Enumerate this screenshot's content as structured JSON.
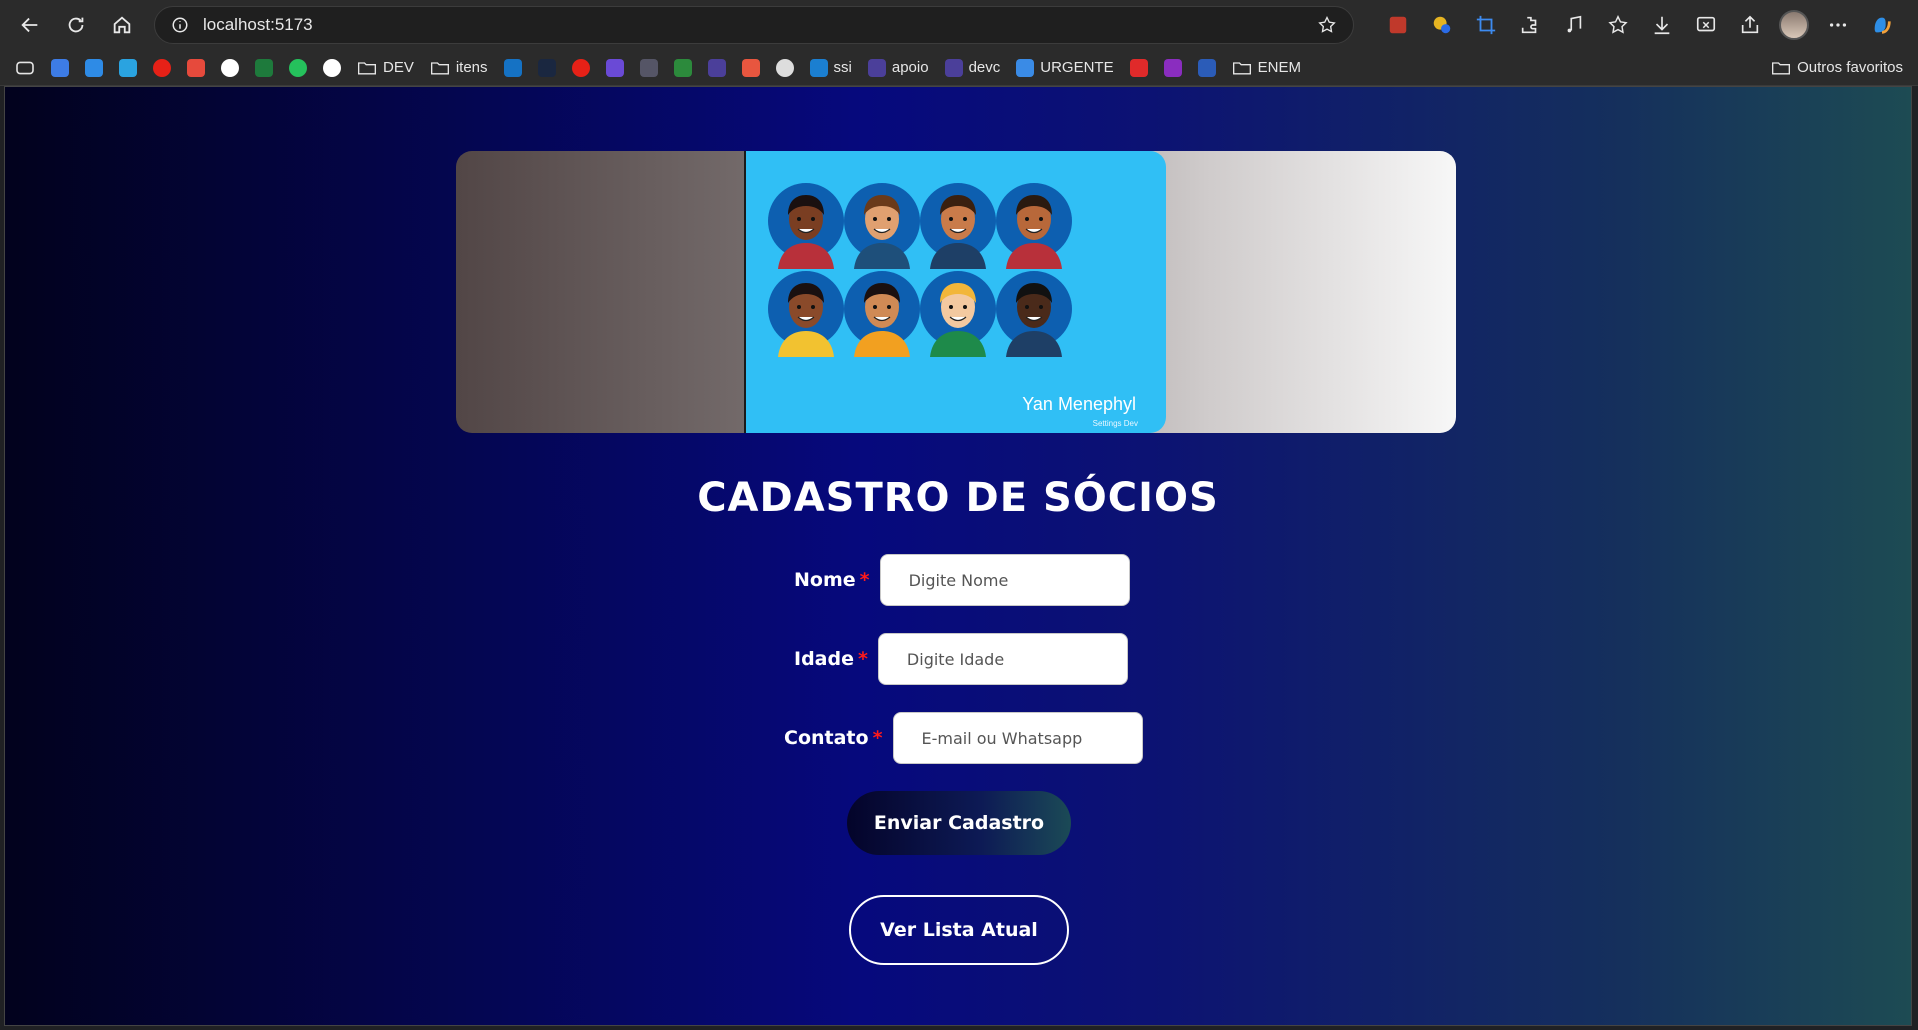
{
  "browser": {
    "url": "localhost:5173",
    "bookmarks": [
      {
        "label": "",
        "icon": "calendar-icon",
        "color": "#3d7ce6"
      },
      {
        "label": "",
        "icon": "onedrive-icon",
        "color": "#2e8be6"
      },
      {
        "label": "",
        "icon": "telegram-icon",
        "color": "#2aa3e0"
      },
      {
        "label": "",
        "icon": "youtube-icon",
        "color": "#e62117"
      },
      {
        "label": "",
        "icon": "gmail-icon",
        "color": "#e64a3c"
      },
      {
        "label": "",
        "icon": "google-icon",
        "color": "#ffffff"
      },
      {
        "label": "",
        "icon": "excel-icon",
        "color": "#1e7a3c"
      },
      {
        "label": "",
        "icon": "whatsapp-icon",
        "color": "#25c15c"
      },
      {
        "label": "",
        "icon": "github-icon",
        "color": "#ffffff"
      },
      {
        "label": "DEV",
        "icon": "folder-icon"
      },
      {
        "label": "itens",
        "icon": "folder-icon"
      },
      {
        "label": "",
        "icon": "linkedin-icon",
        "color": "#1572c4"
      },
      {
        "label": "",
        "icon": "terminal-icon",
        "color": "#1a2740"
      },
      {
        "label": "",
        "icon": "youtube-icon",
        "color": "#e62117"
      },
      {
        "label": "",
        "icon": "app-icon",
        "color": "#6a4ad6"
      },
      {
        "label": "",
        "icon": "app-icon",
        "color": "#555566"
      },
      {
        "label": "",
        "icon": "app-icon",
        "color": "#2c8a3c"
      },
      {
        "label": "",
        "icon": "app-icon",
        "color": "#4b3f9a"
      },
      {
        "label": "",
        "icon": "figma-icon",
        "color": "#e8563f"
      },
      {
        "label": "",
        "icon": "openai-icon",
        "color": "#dddddd"
      },
      {
        "label": "ssi",
        "icon": "app-icon",
        "color": "#1b7fd1"
      },
      {
        "label": "apoio",
        "icon": "app-icon",
        "color": "#4b3f9a"
      },
      {
        "label": "devc",
        "icon": "app-icon",
        "color": "#4b3f9a"
      },
      {
        "label": "URGENTE",
        "icon": "app-icon",
        "color": "#3a8be6"
      },
      {
        "label": "",
        "icon": "app-icon",
        "color": "#e02a2a"
      },
      {
        "label": "",
        "icon": "onenote-icon",
        "color": "#8a2dbf"
      },
      {
        "label": "",
        "icon": "word-icon",
        "color": "#2b5cb8"
      },
      {
        "label": "ENEM",
        "icon": "folder-icon"
      }
    ],
    "other_favorites": "Outros favoritos"
  },
  "banner": {
    "name": "Yan Menephyl",
    "subtitle": "Settings Dev"
  },
  "page": {
    "title": "CADASTRO DE SÓCIOS",
    "fields": [
      {
        "label": "Nome",
        "required": "*",
        "placeholder": "Digite Nome"
      },
      {
        "label": "Idade",
        "required": "*",
        "placeholder": "Digite Idade"
      },
      {
        "label": "Contato",
        "required": "*",
        "placeholder": "E-mail ou Whatsapp"
      }
    ],
    "submit_label": "Enviar Cadastro",
    "list_label": "Ver Lista Atual"
  },
  "colors": {
    "accent_required": "#ff1a1a",
    "banner_art_bg": "#30bff5"
  }
}
